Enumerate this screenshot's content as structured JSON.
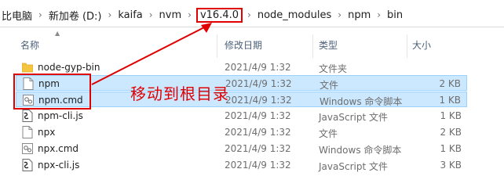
{
  "breadcrumb": [
    {
      "label": "比电脑"
    },
    {
      "label": "新加卷 (D:)"
    },
    {
      "label": "kaifa"
    },
    {
      "label": "nvm"
    },
    {
      "label": "v16.4.0",
      "highlighted": true
    },
    {
      "label": "node_modules"
    },
    {
      "label": "npm"
    },
    {
      "label": "bin"
    }
  ],
  "columns": {
    "name": "名称",
    "date": "修改日期",
    "type": "类型",
    "size": "大小"
  },
  "files": [
    {
      "name": "node-gyp-bin",
      "date": "2021/4/9 1:32",
      "type": "文件夹",
      "size": "",
      "icon": "folder-icon",
      "selected": false
    },
    {
      "name": "npm",
      "date": "2021/4/9 1:32",
      "type": "文件",
      "size": "2 KB",
      "icon": "file-icon",
      "selected": true
    },
    {
      "name": "npm.cmd",
      "date": "2021/4/9 1:32",
      "type": "Windows 命令脚本",
      "size": "1 KB",
      "icon": "cmd-file-icon",
      "selected": true
    },
    {
      "name": "npm-cli.js",
      "date": "2021/4/9 1:32",
      "type": "JavaScript 文件",
      "size": "1 KB",
      "icon": "js-file-icon",
      "selected": false
    },
    {
      "name": "npx",
      "date": "2021/4/9 1:32",
      "type": "文件",
      "size": "2 KB",
      "icon": "file-icon",
      "selected": false
    },
    {
      "name": "npx.cmd",
      "date": "2021/4/9 1:32",
      "type": "Windows 命令脚本",
      "size": "1 KB",
      "icon": "cmd-file-icon",
      "selected": false
    },
    {
      "name": "npx-cli.js",
      "date": "2021/4/9 1:32",
      "type": "JavaScript 文件",
      "size": "3 KB",
      "icon": "js-file-icon",
      "selected": false
    }
  ],
  "annotation": {
    "text": "移动到根目录",
    "color": "#e00000"
  },
  "colors": {
    "selection": "#cce8ff",
    "selection_border": "#99d1ff",
    "header_text": "#4c607a",
    "annotation_red": "#e00000"
  }
}
